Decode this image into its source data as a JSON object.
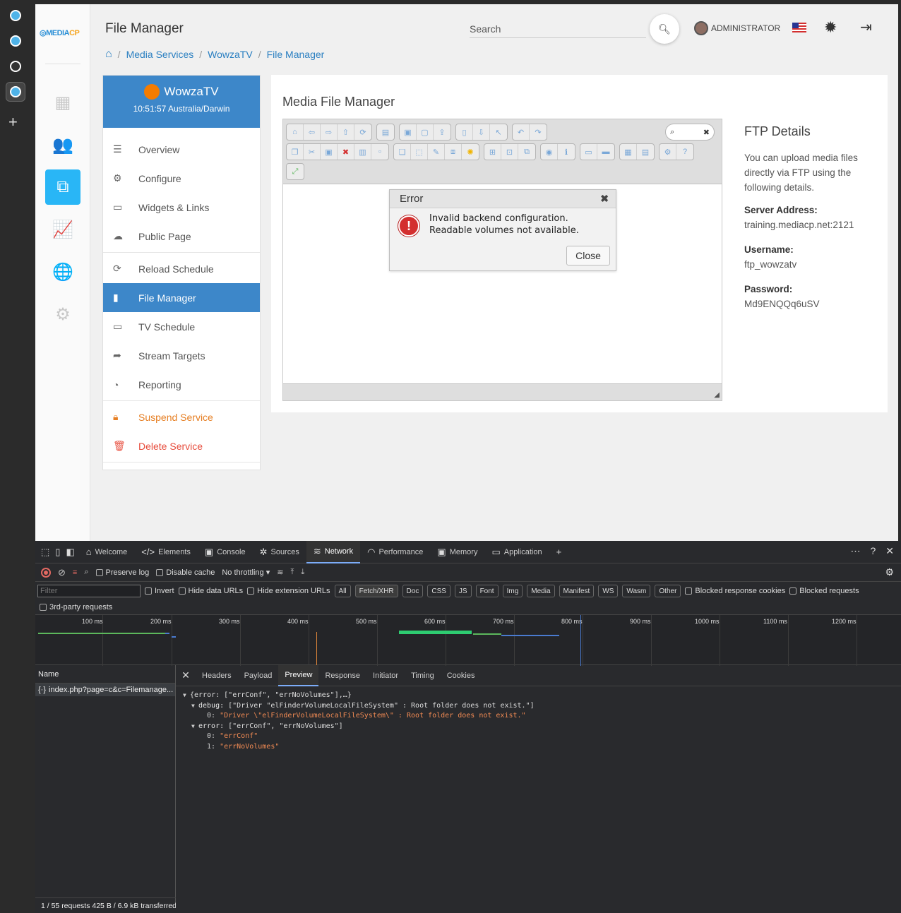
{
  "app": {
    "logo": {
      "main": "MEDIA",
      "accent": "CP"
    },
    "page_title": "File Manager",
    "search_placeholder": "Search",
    "user": "ADMINISTRATOR",
    "breadcrumb": [
      "Media Services",
      "WowzaTV",
      "File Manager"
    ]
  },
  "service": {
    "name": "WowzaTV",
    "time": "10:51:57 Australia/Darwin",
    "menu": [
      {
        "label": "Overview",
        "icon": "list-icon"
      },
      {
        "label": "Configure",
        "icon": "cogs-icon"
      },
      {
        "label": "Widgets & Links",
        "icon": "widgets-icon"
      },
      {
        "label": "Public Page",
        "icon": "cloud-icon"
      },
      {
        "label": "Reload Schedule",
        "icon": "refresh-icon"
      },
      {
        "label": "File Manager",
        "icon": "file-icon"
      },
      {
        "label": "TV Schedule",
        "icon": "monitor-icon"
      },
      {
        "label": "Stream Targets",
        "icon": "share-icon"
      },
      {
        "label": "Reporting",
        "icon": "pie-chart-icon"
      },
      {
        "label": "Suspend Service",
        "icon": "lock-icon"
      },
      {
        "label": "Delete Service",
        "icon": "trash-icon"
      }
    ]
  },
  "content": {
    "title": "Media File Manager",
    "dialog": {
      "title": "Error",
      "line1": "Invalid backend configuration.",
      "line2": "Readable volumes not available.",
      "close": "Close"
    },
    "ftp": {
      "title": "FTP Details",
      "description": "You can upload media files directly via FTP using the following details.",
      "server_label": "Server Address:",
      "server": "training.mediacp.net:2121",
      "username_label": "Username:",
      "username": "ftp_wowzatv",
      "password_label": "Password:",
      "password": "Md9ENQQq6uSV"
    }
  },
  "devtools": {
    "tabs": [
      "Welcome",
      "Elements",
      "Console",
      "Sources",
      "Network",
      "Performance",
      "Memory",
      "Application"
    ],
    "toolbar": {
      "preserve": "Preserve log",
      "disable_cache": "Disable cache",
      "throttle": "No throttling"
    },
    "filter_placeholder": "Filter",
    "filter_options": [
      "Invert",
      "Hide data URLs",
      "Hide extension URLs"
    ],
    "types": [
      "All",
      "Fetch/XHR",
      "Doc",
      "CSS",
      "JS",
      "Font",
      "Img",
      "Media",
      "Manifest",
      "WS",
      "Wasm",
      "Other"
    ],
    "blocked": [
      "Blocked response cookies",
      "Blocked requests"
    ],
    "third_party": "3rd-party requests",
    "timeline": [
      "100 ms",
      "200 ms",
      "300 ms",
      "400 ms",
      "500 ms",
      "600 ms",
      "700 ms",
      "800 ms",
      "900 ms",
      "1000 ms",
      "1100 ms",
      "1200 ms"
    ],
    "name_header": "Name",
    "request": "index.php?page=c&c=Filemanage...",
    "status": "1 / 55 requests  425 B / 6.9 kB transferred",
    "detail_tabs": [
      "Headers",
      "Payload",
      "Preview",
      "Response",
      "Initiator",
      "Timing",
      "Cookies"
    ],
    "preview": {
      "summary": "{error: [\"errConf\", \"errNoVolumes\"],…}",
      "debug_key": "debug:",
      "debug_val": " [\"Driver \"elFinderVolumeLocalFileSystem\" : Root folder does not exist.\"]",
      "debug_0_idx": "0:",
      "debug_0": " \"Driver \\\"elFinderVolumeLocalFileSystem\\\" : Root folder does not exist.\"",
      "error_key": "error:",
      "error_val": " [\"errConf\", \"errNoVolumes\"]",
      "error_0_idx": "0:",
      "error_0": " \"errConf\"",
      "error_1_idx": "1:",
      "error_1": " \"errNoVolumes\""
    }
  }
}
